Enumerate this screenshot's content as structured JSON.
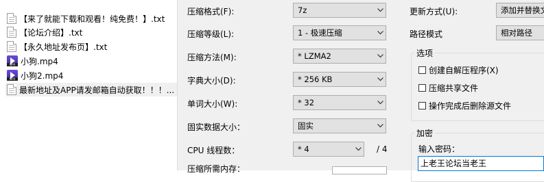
{
  "files": [
    {
      "name": "【来了就能下载和观看！纯免费！】.txt",
      "type": "txt"
    },
    {
      "name": "【论坛介绍】.txt",
      "type": "txt"
    },
    {
      "name": "【永久地址发布页】.txt",
      "type": "txt"
    },
    {
      "name": "小狗.mp4",
      "type": "mp4"
    },
    {
      "name": "小狗2.mp4",
      "type": "mp4"
    },
    {
      "name": "最新地址及APP请发邮箱自动获取！！！...",
      "type": "txt"
    }
  ],
  "mp4_tag": "MP4",
  "options": {
    "format": {
      "label": "压缩格式(F):",
      "value": "7z"
    },
    "level": {
      "label": "压缩等级(L):",
      "value": "1 - 极速压缩"
    },
    "method": {
      "label": "压缩方法(M):",
      "value": "* LZMA2"
    },
    "dict": {
      "label": "字典大小(D):",
      "value": "* 256 KB"
    },
    "word": {
      "label": "单词大小(W):",
      "value": "* 32"
    },
    "solid": {
      "label": "固实数据大小：",
      "value": "固实"
    },
    "threads": {
      "label": "CPU 线程数：",
      "value": "* 4",
      "total": "/ 4"
    },
    "memory": {
      "label": "压缩所需内存："
    }
  },
  "update": {
    "label": "更新方式(U):",
    "value": "添加并替换文件"
  },
  "path": {
    "label": "路径模式",
    "value": "相对路径"
  },
  "options_group": {
    "title": "选项",
    "checks": [
      {
        "label": "创建自解压程序(X)",
        "checked": false
      },
      {
        "label": "压缩共享文件",
        "checked": false
      },
      {
        "label": "操作完成后删除源文件",
        "checked": false
      }
    ]
  },
  "encrypt": {
    "title": "加密",
    "pwd_label": "输入密码：",
    "pwd_value": "上老王论坛当老王"
  }
}
